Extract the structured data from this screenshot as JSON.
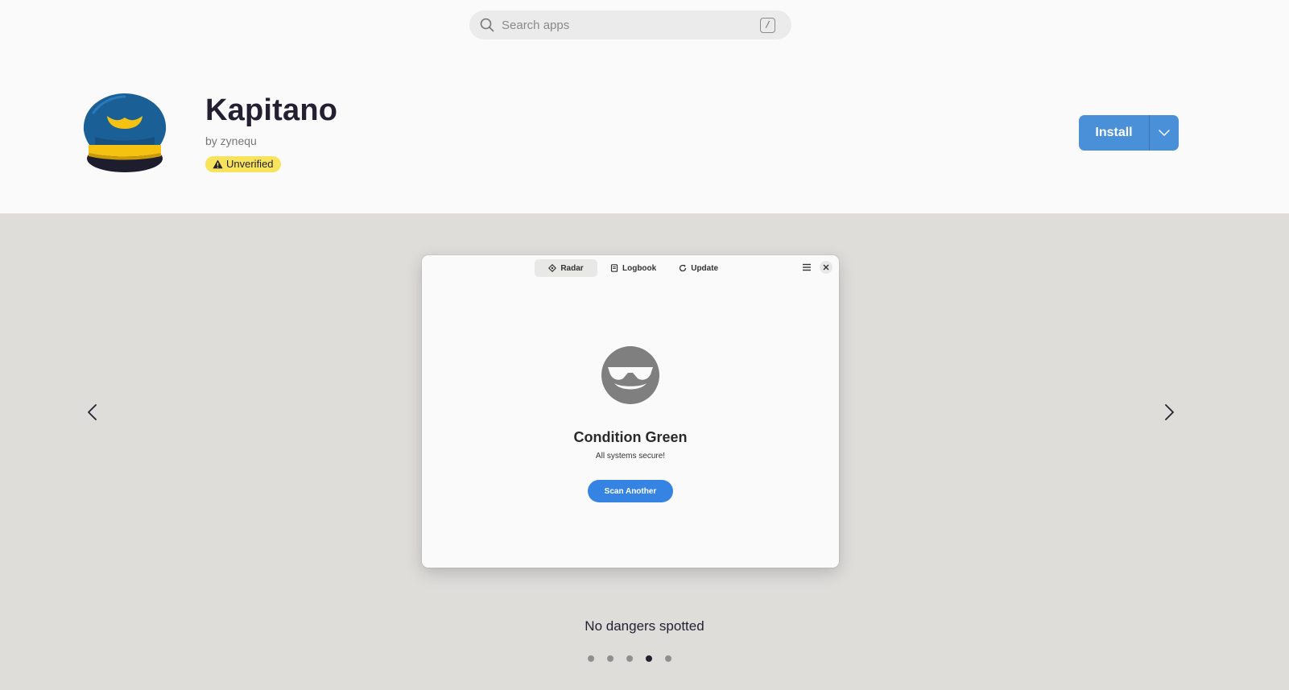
{
  "search": {
    "placeholder": "Search apps",
    "shortcut": "/"
  },
  "app": {
    "name": "Kapitano",
    "author": "by zynequ",
    "badge": "Unverified",
    "icon": "captain-hat-icon"
  },
  "actions": {
    "install_label": "Install"
  },
  "gallery": {
    "screenshot": {
      "tabs": [
        {
          "label": "Radar",
          "icon": "radar-icon",
          "active": true
        },
        {
          "label": "Logbook",
          "icon": "logbook-icon",
          "active": false
        },
        {
          "label": "Update",
          "icon": "refresh-icon",
          "active": false
        }
      ],
      "status_title": "Condition Green",
      "status_subtitle": "All systems secure!",
      "scan_button": "Scan Another"
    },
    "caption": "No dangers spotted",
    "total_slides": 5,
    "current_slide": 4
  },
  "colors": {
    "accent": "#4a90d9",
    "badge": "#f8e45c",
    "gallery_bg": "#deddda"
  }
}
